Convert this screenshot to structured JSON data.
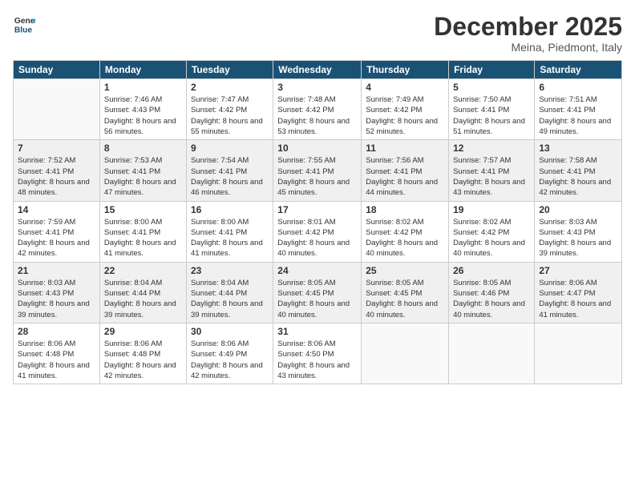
{
  "logo": {
    "general": "General",
    "blue": "Blue"
  },
  "header": {
    "month": "December 2025",
    "location": "Meina, Piedmont, Italy"
  },
  "days_of_week": [
    "Sunday",
    "Monday",
    "Tuesday",
    "Wednesday",
    "Thursday",
    "Friday",
    "Saturday"
  ],
  "weeks": [
    [
      {
        "day": "",
        "sunrise": "",
        "sunset": "",
        "daylight": "",
        "empty": true
      },
      {
        "day": "1",
        "sunrise": "Sunrise: 7:46 AM",
        "sunset": "Sunset: 4:43 PM",
        "daylight": "Daylight: 8 hours and 56 minutes."
      },
      {
        "day": "2",
        "sunrise": "Sunrise: 7:47 AM",
        "sunset": "Sunset: 4:42 PM",
        "daylight": "Daylight: 8 hours and 55 minutes."
      },
      {
        "day": "3",
        "sunrise": "Sunrise: 7:48 AM",
        "sunset": "Sunset: 4:42 PM",
        "daylight": "Daylight: 8 hours and 53 minutes."
      },
      {
        "day": "4",
        "sunrise": "Sunrise: 7:49 AM",
        "sunset": "Sunset: 4:42 PM",
        "daylight": "Daylight: 8 hours and 52 minutes."
      },
      {
        "day": "5",
        "sunrise": "Sunrise: 7:50 AM",
        "sunset": "Sunset: 4:41 PM",
        "daylight": "Daylight: 8 hours and 51 minutes."
      },
      {
        "day": "6",
        "sunrise": "Sunrise: 7:51 AM",
        "sunset": "Sunset: 4:41 PM",
        "daylight": "Daylight: 8 hours and 49 minutes."
      }
    ],
    [
      {
        "day": "7",
        "sunrise": "Sunrise: 7:52 AM",
        "sunset": "Sunset: 4:41 PM",
        "daylight": "Daylight: 8 hours and 48 minutes."
      },
      {
        "day": "8",
        "sunrise": "Sunrise: 7:53 AM",
        "sunset": "Sunset: 4:41 PM",
        "daylight": "Daylight: 8 hours and 47 minutes."
      },
      {
        "day": "9",
        "sunrise": "Sunrise: 7:54 AM",
        "sunset": "Sunset: 4:41 PM",
        "daylight": "Daylight: 8 hours and 46 minutes."
      },
      {
        "day": "10",
        "sunrise": "Sunrise: 7:55 AM",
        "sunset": "Sunset: 4:41 PM",
        "daylight": "Daylight: 8 hours and 45 minutes."
      },
      {
        "day": "11",
        "sunrise": "Sunrise: 7:56 AM",
        "sunset": "Sunset: 4:41 PM",
        "daylight": "Daylight: 8 hours and 44 minutes."
      },
      {
        "day": "12",
        "sunrise": "Sunrise: 7:57 AM",
        "sunset": "Sunset: 4:41 PM",
        "daylight": "Daylight: 8 hours and 43 minutes."
      },
      {
        "day": "13",
        "sunrise": "Sunrise: 7:58 AM",
        "sunset": "Sunset: 4:41 PM",
        "daylight": "Daylight: 8 hours and 42 minutes."
      }
    ],
    [
      {
        "day": "14",
        "sunrise": "Sunrise: 7:59 AM",
        "sunset": "Sunset: 4:41 PM",
        "daylight": "Daylight: 8 hours and 42 minutes."
      },
      {
        "day": "15",
        "sunrise": "Sunrise: 8:00 AM",
        "sunset": "Sunset: 4:41 PM",
        "daylight": "Daylight: 8 hours and 41 minutes."
      },
      {
        "day": "16",
        "sunrise": "Sunrise: 8:00 AM",
        "sunset": "Sunset: 4:41 PM",
        "daylight": "Daylight: 8 hours and 41 minutes."
      },
      {
        "day": "17",
        "sunrise": "Sunrise: 8:01 AM",
        "sunset": "Sunset: 4:42 PM",
        "daylight": "Daylight: 8 hours and 40 minutes."
      },
      {
        "day": "18",
        "sunrise": "Sunrise: 8:02 AM",
        "sunset": "Sunset: 4:42 PM",
        "daylight": "Daylight: 8 hours and 40 minutes."
      },
      {
        "day": "19",
        "sunrise": "Sunrise: 8:02 AM",
        "sunset": "Sunset: 4:42 PM",
        "daylight": "Daylight: 8 hours and 40 minutes."
      },
      {
        "day": "20",
        "sunrise": "Sunrise: 8:03 AM",
        "sunset": "Sunset: 4:43 PM",
        "daylight": "Daylight: 8 hours and 39 minutes."
      }
    ],
    [
      {
        "day": "21",
        "sunrise": "Sunrise: 8:03 AM",
        "sunset": "Sunset: 4:43 PM",
        "daylight": "Daylight: 8 hours and 39 minutes."
      },
      {
        "day": "22",
        "sunrise": "Sunrise: 8:04 AM",
        "sunset": "Sunset: 4:44 PM",
        "daylight": "Daylight: 8 hours and 39 minutes."
      },
      {
        "day": "23",
        "sunrise": "Sunrise: 8:04 AM",
        "sunset": "Sunset: 4:44 PM",
        "daylight": "Daylight: 8 hours and 39 minutes."
      },
      {
        "day": "24",
        "sunrise": "Sunrise: 8:05 AM",
        "sunset": "Sunset: 4:45 PM",
        "daylight": "Daylight: 8 hours and 40 minutes."
      },
      {
        "day": "25",
        "sunrise": "Sunrise: 8:05 AM",
        "sunset": "Sunset: 4:45 PM",
        "daylight": "Daylight: 8 hours and 40 minutes."
      },
      {
        "day": "26",
        "sunrise": "Sunrise: 8:05 AM",
        "sunset": "Sunset: 4:46 PM",
        "daylight": "Daylight: 8 hours and 40 minutes."
      },
      {
        "day": "27",
        "sunrise": "Sunrise: 8:06 AM",
        "sunset": "Sunset: 4:47 PM",
        "daylight": "Daylight: 8 hours and 41 minutes."
      }
    ],
    [
      {
        "day": "28",
        "sunrise": "Sunrise: 8:06 AM",
        "sunset": "Sunset: 4:48 PM",
        "daylight": "Daylight: 8 hours and 41 minutes."
      },
      {
        "day": "29",
        "sunrise": "Sunrise: 8:06 AM",
        "sunset": "Sunset: 4:48 PM",
        "daylight": "Daylight: 8 hours and 42 minutes."
      },
      {
        "day": "30",
        "sunrise": "Sunrise: 8:06 AM",
        "sunset": "Sunset: 4:49 PM",
        "daylight": "Daylight: 8 hours and 42 minutes."
      },
      {
        "day": "31",
        "sunrise": "Sunrise: 8:06 AM",
        "sunset": "Sunset: 4:50 PM",
        "daylight": "Daylight: 8 hours and 43 minutes."
      },
      {
        "day": "",
        "sunrise": "",
        "sunset": "",
        "daylight": "",
        "empty": true
      },
      {
        "day": "",
        "sunrise": "",
        "sunset": "",
        "daylight": "",
        "empty": true
      },
      {
        "day": "",
        "sunrise": "",
        "sunset": "",
        "daylight": "",
        "empty": true
      }
    ]
  ]
}
